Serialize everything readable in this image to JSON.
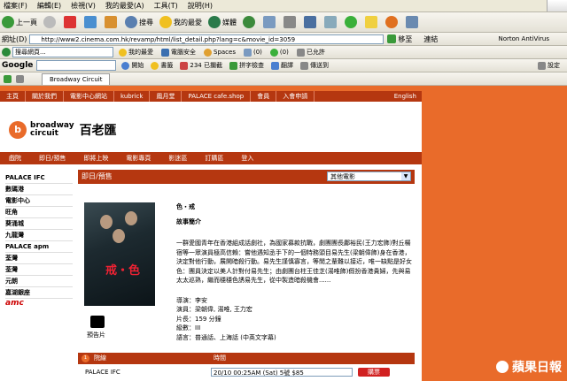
{
  "browser": {
    "menu": [
      "檔案(F)",
      "編輯(E)",
      "檢視(V)",
      "我的最愛(A)",
      "工具(T)",
      "說明(H)"
    ],
    "toolbar": {
      "back": "上一頁",
      "search": "搜尋",
      "favorites": "我的最愛",
      "media": "媒體"
    },
    "address_label": "網址(D)",
    "address": "http://www2.cinema.com.hk/revamp/html/list_detail.php?lang=c&movie_id=3059",
    "go": "移至",
    "links_label": "連結",
    "norton": "Norton AntiVirus",
    "links_search_placeholder": "搜尋網頁...",
    "links_items": [
      "我的最愛",
      "電腦安全",
      "Spaces",
      "(0)",
      "(0)",
      "已允許"
    ],
    "google": {
      "logo": "Google",
      "items": [
        "開始",
        "書籤",
        "234 已攔截",
        "拼字檢查",
        "翻譯",
        "傳送到"
      ],
      "settings": "設定"
    },
    "tab_title": "Broadway Circuit"
  },
  "site": {
    "top_nav": [
      "主頁",
      "關於我們",
      "電影中心網站",
      "kubrick",
      "鳳月堂",
      "PALACE cafe.shop",
      "會員",
      "入會申請",
      "English"
    ],
    "logo": {
      "mark": "b",
      "line1": "broadway",
      "line2": "circuit",
      "chinese": "百老匯"
    },
    "cinema_nav": [
      "戲院",
      "即日/預售",
      "即將上映",
      "電影專頁",
      "影迷區",
      "訂購區",
      "登入"
    ],
    "cinemas": [
      "PALACE IFC",
      "數碼港",
      "電影中心",
      "旺角",
      "葵涌城",
      "九龍灣",
      "PALACE apm",
      "荃灣",
      "荃灣",
      "元朗",
      "嘉湖銀座"
    ],
    "amc": "amc",
    "section_title": "即日/預售",
    "select_label": "其他電影",
    "movie": {
      "poster_title": "戒・色",
      "title": "色・戒",
      "synopsis_heading": "故事簡介",
      "synopsis": "一群愛國青年在香港組成話劇社，為國家募款抗戰，劇團團長鄺裕民(王力宏飾)對丘楊宿等一眾演員極高信賴：嘗他遇知丞手下的一個特務頭目易先生(梁朝偉飾)身在香港，決定對他行動，展開暗殺行動。易先生謹慎寡言，等閒之輩難以接近，唯一缺點是好女色：團員決定以美人計對付易先生；由劇團台柱王佳芝(湯唯飾)假扮香港貴婦，先與易太太巡熟，繼而穩穩色誘易先生，從中製造暗殺機會......",
      "trailer": "預告片",
      "director": "導演：李安",
      "cast": "演員：梁朝偉, 湯唯, 王力宏",
      "runtime": "片長：159 分鐘",
      "rating": "級數：III",
      "language": "語言：普通話、上海話 (中英文字幕)"
    },
    "showtime": {
      "num": "1",
      "col_cinema": "院線",
      "col_time": "時間",
      "cinema": "PALACE IFC",
      "selected": "20/10 00:25AM (Sat) 5號 $85",
      "buy": "購票"
    }
  },
  "watermark": "蘋果日報"
}
